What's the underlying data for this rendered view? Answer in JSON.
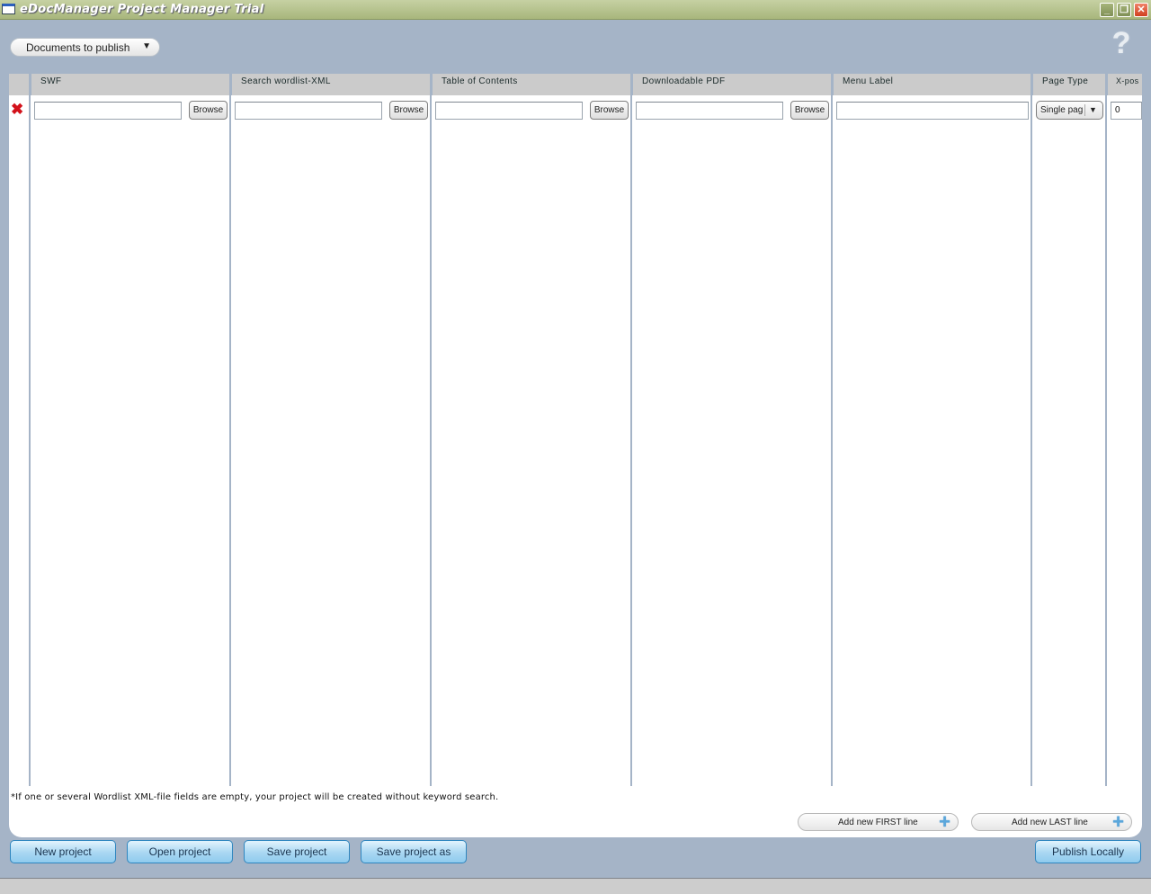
{
  "window": {
    "title": "eDocManager Project Manager Trial",
    "controls": {
      "minimize": "_",
      "maximize": "❐",
      "close": "✕"
    }
  },
  "toolbar": {
    "documents_dropdown": {
      "selected": "Documents to publish",
      "arrow": "▼"
    },
    "help_icon": "?"
  },
  "table": {
    "columns": [
      {
        "key": "delete",
        "label": ""
      },
      {
        "key": "swf",
        "label": "SWF"
      },
      {
        "key": "search_wordlist",
        "label": "Search wordlist-XML"
      },
      {
        "key": "toc",
        "label": "Table of Contents"
      },
      {
        "key": "pdf",
        "label": "Downloadable PDF"
      },
      {
        "key": "menu_label",
        "label": "Menu Label"
      },
      {
        "key": "page_type",
        "label": "Page Type"
      },
      {
        "key": "xpos",
        "label": "X-pos"
      }
    ],
    "rows": [
      {
        "delete_icon": "✖",
        "swf": "",
        "search_wordlist": "",
        "toc": "",
        "pdf": "",
        "menu_label": "",
        "page_type": "Single pag",
        "page_type_arrow": "▼",
        "xpos": "0"
      }
    ],
    "browse_label": "Browse"
  },
  "note": "*If one or several Wordlist XML-file fields are empty, your project will be created without keyword search.",
  "add_buttons": {
    "first": {
      "label": "Add new FIRST line",
      "icon": "+"
    },
    "last": {
      "label": "Add new LAST line",
      "icon": "+"
    }
  },
  "footer_buttons": {
    "new_project": "New project",
    "open_project": "Open project",
    "save_project": "Save project",
    "save_project_as": "Save project as",
    "publish_locally": "Publish Locally"
  }
}
